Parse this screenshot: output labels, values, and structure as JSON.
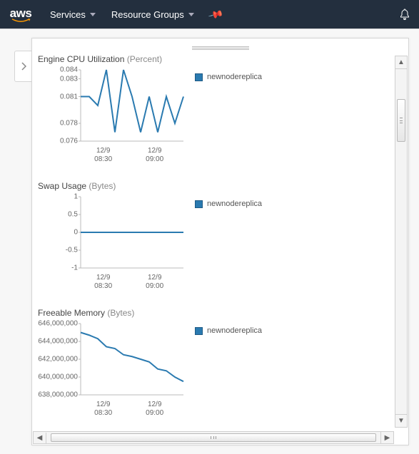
{
  "nav": {
    "logo_text": "aws",
    "services_label": "Services",
    "resource_groups_label": "Resource Groups"
  },
  "legend_label": "newnodereplica",
  "colors": {
    "series": "#2a7ab0"
  },
  "chart_data": [
    {
      "type": "line",
      "title": "Engine CPU Utilization",
      "unit": "Percent",
      "ylabel": "",
      "xlabel": "",
      "ylim": [
        0.076,
        0.084
      ],
      "yticks": [
        0.084,
        0.083,
        0.081,
        0.078,
        0.076
      ],
      "categories": [
        "12/9\n08:30",
        "12/9\n09:00"
      ],
      "series": [
        {
          "name": "newnodereplica",
          "x": [
            0,
            1,
            2,
            3,
            4,
            5,
            6,
            7,
            8,
            9,
            10,
            11,
            12
          ],
          "values": [
            0.081,
            0.081,
            0.08,
            0.084,
            0.077,
            0.084,
            0.081,
            0.077,
            0.081,
            0.077,
            0.081,
            0.078,
            0.081
          ]
        }
      ]
    },
    {
      "type": "line",
      "title": "Swap Usage",
      "unit": "Bytes",
      "ylabel": "",
      "xlabel": "",
      "ylim": [
        -1,
        1
      ],
      "yticks": [
        1,
        0.5,
        0,
        -0.5,
        -1
      ],
      "categories": [
        "12/9\n08:30",
        "12/9\n09:00"
      ],
      "series": [
        {
          "name": "newnodereplica",
          "x": [
            0,
            1,
            2,
            3,
            4,
            5,
            6,
            7,
            8,
            9,
            10,
            11,
            12
          ],
          "values": [
            0,
            0,
            0,
            0,
            0,
            0,
            0,
            0,
            0,
            0,
            0,
            0,
            0
          ]
        }
      ]
    },
    {
      "type": "line",
      "title": "Freeable Memory",
      "unit": "Bytes",
      "ylabel": "",
      "xlabel": "",
      "ylim": [
        638000000,
        646000000
      ],
      "yticks": [
        646000000,
        644000000,
        642000000,
        640000000,
        638000000
      ],
      "categories": [
        "12/9\n08:30",
        "12/9\n09:00"
      ],
      "series": [
        {
          "name": "newnodereplica",
          "x": [
            0,
            1,
            2,
            3,
            4,
            5,
            6,
            7,
            8,
            9,
            10,
            11,
            12
          ],
          "values": [
            645000000,
            644700000,
            644300000,
            643400000,
            643200000,
            642500000,
            642300000,
            642000000,
            641700000,
            640900000,
            640700000,
            640000000,
            639500000
          ]
        }
      ]
    }
  ]
}
